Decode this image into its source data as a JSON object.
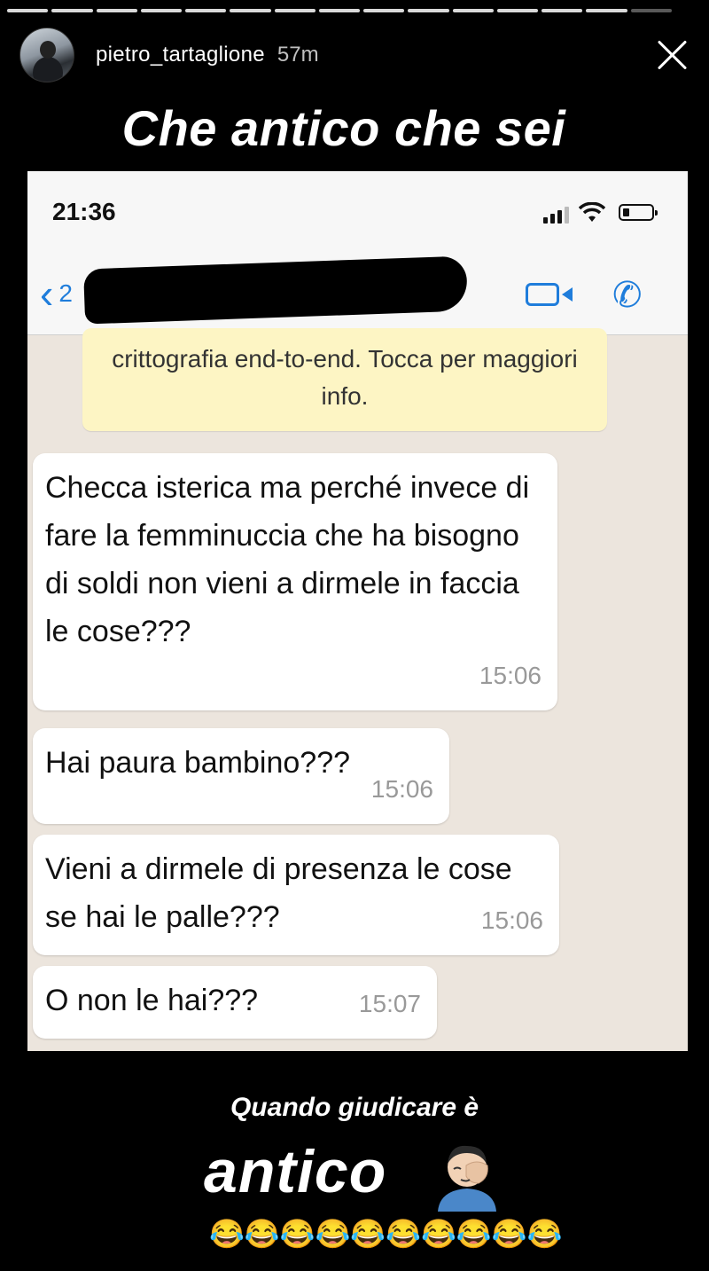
{
  "story": {
    "username": "pietro_tartaglione",
    "time_ago": "57m",
    "caption_top": "Che antico che sei",
    "caption_bottom_line1": "Quando giudicare è",
    "caption_bottom_line2": "antico",
    "laugh_emojis": "😂😂😂😂😂😂😂😂😂😂",
    "progress_segments": 15,
    "progress_active": 14
  },
  "phone": {
    "status_time": "21:36",
    "nav": {
      "back_chevron": "‹",
      "back_count": "2",
      "call_icon": "✆"
    },
    "encryption_notice": "crittografia end-to-end. Tocca per maggiori info.",
    "messages": [
      {
        "text": "Checca isterica ma perché invece di fare la femminuccia che ha bisogno di soldi non vieni a dirmele in faccia le cose???",
        "time": "15:06"
      },
      {
        "text": "Hai paura bambino???",
        "time": "15:06"
      },
      {
        "text": "Vieni a dirmele di presenza le cose se hai le palle???",
        "time": "15:06"
      },
      {
        "text": "O non le hai???",
        "time": "15:07"
      }
    ]
  },
  "icons": {
    "wifi": "wifi-icon",
    "facepalm": "facepalm-emoji-icon",
    "close": "close-icon"
  }
}
